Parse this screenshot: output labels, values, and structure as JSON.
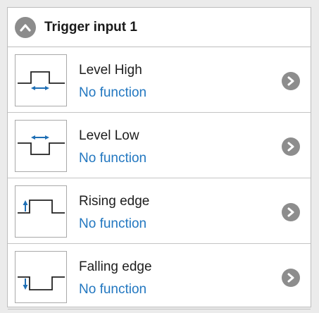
{
  "header": {
    "title": "Trigger input 1",
    "collapse_icon": "chevron-up-icon"
  },
  "items": [
    {
      "title": "Level High",
      "value": "No function",
      "icon": "level-high-icon"
    },
    {
      "title": "Level Low",
      "value": "No function",
      "icon": "level-low-icon"
    },
    {
      "title": "Rising edge",
      "value": "No function",
      "icon": "rising-edge-icon"
    },
    {
      "title": "Falling edge",
      "value": "No function",
      "icon": "falling-edge-icon"
    }
  ],
  "colors": {
    "accent_blue": "#2277c0",
    "icon_grey": "#8d8d8d"
  }
}
